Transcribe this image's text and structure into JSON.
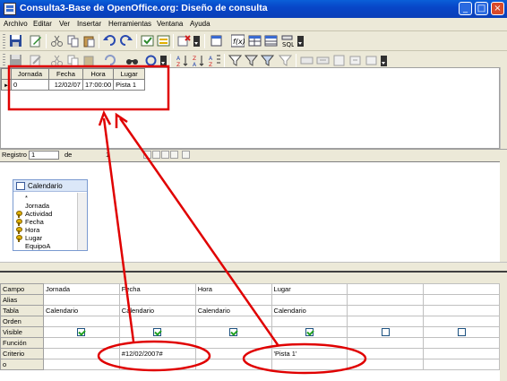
{
  "window": {
    "title": "Consulta3-Base de OpenOffice.org: Diseño de consulta"
  },
  "menu": [
    "Archivo",
    "Editar",
    "Ver",
    "Insertar",
    "Herramientas",
    "Ventana",
    "Ayuda"
  ],
  "result": {
    "columns": [
      "Jornada",
      "Fecha",
      "Hora",
      "Lugar"
    ],
    "row": [
      "0",
      "12/02/07",
      "17:00:00",
      "Pista 1"
    ]
  },
  "navigation": {
    "label": "Registro",
    "current": "1",
    "of": "de",
    "total": "1"
  },
  "table_window": {
    "title": "Calendario",
    "fields": [
      {
        "name": "*",
        "key": false
      },
      {
        "name": "Jornada",
        "key": false
      },
      {
        "name": "Actividad",
        "key": true
      },
      {
        "name": "Fecha",
        "key": true
      },
      {
        "name": "Hora",
        "key": true
      },
      {
        "name": "Lugar",
        "key": true
      },
      {
        "name": "EquipoA",
        "key": false
      }
    ]
  },
  "design_grid": {
    "row_labels": [
      "Campo",
      "Alias",
      "Tabla",
      "Orden",
      "Visible",
      "Función",
      "Criterio",
      "o"
    ],
    "columns": [
      {
        "campo": "Jornada",
        "tabla": "Calendario",
        "visible": true,
        "criterio": ""
      },
      {
        "campo": "Fecha",
        "tabla": "Calendario",
        "visible": true,
        "criterio": "#12/02/2007#"
      },
      {
        "campo": "Hora",
        "tabla": "Calendario",
        "visible": true,
        "criterio": ""
      },
      {
        "campo": "Lugar",
        "tabla": "Calendario",
        "visible": true,
        "criterio": "'Pista 1'"
      },
      {
        "campo": "",
        "tabla": "",
        "visible": false,
        "criterio": ""
      },
      {
        "campo": "",
        "tabla": "",
        "visible": false,
        "criterio": ""
      }
    ]
  },
  "annotation_color": "#e00000"
}
